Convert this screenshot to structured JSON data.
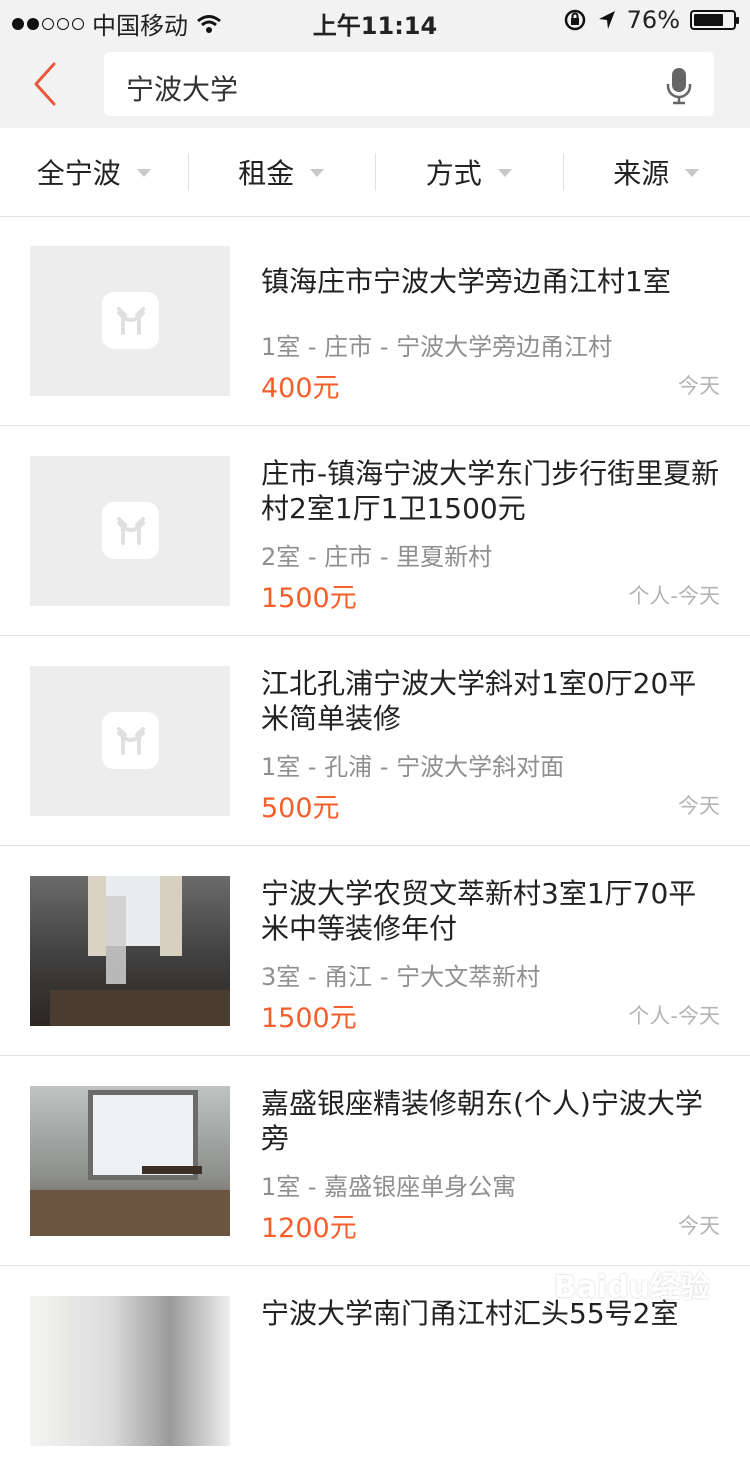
{
  "status_bar": {
    "carrier": "中国移动",
    "time": "上午11:14",
    "battery": "76%",
    "battery_level": 0.76
  },
  "search": {
    "query": "宁波大学"
  },
  "filters": [
    {
      "label": "全宁波"
    },
    {
      "label": "租金"
    },
    {
      "label": "方式"
    },
    {
      "label": "来源"
    }
  ],
  "listings": [
    {
      "title": "镇海庄市宁波大学旁边甬江村1室",
      "meta": "1室 - 庄市 - 宁波大学旁边甬江村",
      "price": "400元",
      "tag": "今天"
    },
    {
      "title": "庄市-镇海宁波大学东门步行街里夏新村2室1厅1卫1500元",
      "meta": "2室 - 庄市 - 里夏新村",
      "price": "1500元",
      "tag": "个人-今天"
    },
    {
      "title": "江北孔浦宁波大学斜对1室0厅20平米简单装修",
      "meta": "1室 - 孔浦 - 宁波大学斜对面",
      "price": "500元",
      "tag": "今天"
    },
    {
      "title": "宁波大学农贸文萃新村3室1厅70平米中等装修年付",
      "meta": "3室 - 甬江 - 宁大文萃新村",
      "price": "1500元",
      "tag": "个人-今天"
    },
    {
      "title": "嘉盛银座精装修朝东(个人)宁波大学旁",
      "meta": "1室 - 嘉盛银座单身公寓",
      "price": "1200元",
      "tag": "今天"
    },
    {
      "title": "宁波大学南门甬江村汇头55号2室",
      "meta": "",
      "price": "",
      "tag": ""
    }
  ],
  "watermark": "Baidu经验",
  "colors": {
    "accent": "#f55f2a",
    "back_arrow": "#e8583a",
    "header_bg": "#f2f2f2",
    "meta_text": "#8f8f8f"
  }
}
